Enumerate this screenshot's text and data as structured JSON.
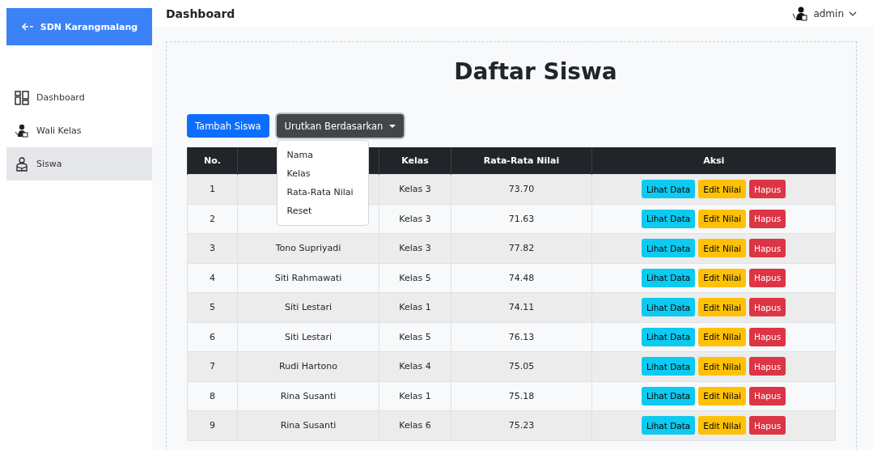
{
  "brand": {
    "title": "SDN Karangmalang"
  },
  "sidebar": {
    "items": [
      {
        "label": "Dashboard",
        "selected": false
      },
      {
        "label": "Wali Kelas",
        "selected": false
      },
      {
        "label": "Siswa",
        "selected": true
      }
    ]
  },
  "header": {
    "title": "Dashboard",
    "user": "admin"
  },
  "page_title": "Daftar Siswa",
  "add_button": "Tambah Siswa",
  "sort_dropdown": {
    "label": "Urutkan Berdasarkan",
    "expanded": true,
    "options": [
      "Nama",
      "Kelas",
      "Rata-Rata Nilai",
      "Reset"
    ]
  },
  "table": {
    "columns": [
      {
        "label": "No."
      },
      {},
      {
        "label": "Kelas"
      },
      {
        "label": "Rata-Rata Nilai"
      },
      {
        "label": "Aksi"
      }
    ],
    "rows": [
      {
        "no": "1",
        "kelas": "Kelas 3",
        "nilai": "73.70",
        "actions": [
          {
            "kind": "view",
            "label": "Lihat Data"
          },
          {
            "kind": "edit",
            "label": "Edit Nilai"
          },
          {
            "kind": "delete",
            "label": "Hapus"
          }
        ]
      },
      {
        "no": "2",
        "kelas": "Kelas 3",
        "nilai": "71.63",
        "actions": [
          {
            "kind": "view",
            "label": "Lihat Data"
          },
          {
            "kind": "edit",
            "label": "Edit Nilai"
          },
          {
            "kind": "delete",
            "label": "Hapus"
          }
        ]
      },
      {
        "no": "3",
        "nama": "Tono Supriyadi",
        "kelas": "Kelas 3",
        "nilai": "77.82",
        "actions": [
          {
            "kind": "view",
            "label": "Lihat Data"
          },
          {
            "kind": "edit",
            "label": "Edit Nilai"
          },
          {
            "kind": "delete",
            "label": "Hapus"
          }
        ]
      },
      {
        "no": "4",
        "nama": "Siti Rahmawati",
        "kelas": "Kelas 5",
        "nilai": "74.48",
        "actions": [
          {
            "kind": "view",
            "label": "Lihat Data"
          },
          {
            "kind": "edit",
            "label": "Edit Nilai"
          },
          {
            "kind": "delete",
            "label": "Hapus"
          }
        ]
      },
      {
        "no": "5",
        "nama": "Siti Lestari",
        "kelas": "Kelas 1",
        "nilai": "74.11",
        "actions": [
          {
            "kind": "view",
            "label": "Lihat Data"
          },
          {
            "kind": "edit",
            "label": "Edit Nilai"
          },
          {
            "kind": "delete",
            "label": "Hapus"
          }
        ]
      },
      {
        "no": "6",
        "nama": "Siti Lestari",
        "kelas": "Kelas 5",
        "nilai": "76.13",
        "actions": [
          {
            "kind": "view",
            "label": "Lihat Data"
          },
          {
            "kind": "edit",
            "label": "Edit Nilai"
          },
          {
            "kind": "delete",
            "label": "Hapus"
          }
        ]
      },
      {
        "no": "7",
        "nama": "Rudi Hartono",
        "kelas": "Kelas 4",
        "nilai": "75.05",
        "actions": [
          {
            "kind": "view",
            "label": "Lihat Data"
          },
          {
            "kind": "edit",
            "label": "Edit Nilai"
          },
          {
            "kind": "delete",
            "label": "Hapus"
          }
        ]
      },
      {
        "no": "8",
        "nama": "Rina Susanti",
        "kelas": "Kelas 1",
        "nilai": "75.18",
        "actions": [
          {
            "kind": "view",
            "label": "Lihat Data"
          },
          {
            "kind": "edit",
            "label": "Edit Nilai"
          },
          {
            "kind": "delete",
            "label": "Hapus"
          }
        ]
      },
      {
        "no": "9",
        "nama": "Rina Susanti",
        "kelas": "Kelas 6",
        "nilai": "75.23",
        "actions": [
          {
            "kind": "view",
            "label": "Lihat Data"
          },
          {
            "kind": "edit",
            "label": "Edit Nilai"
          },
          {
            "kind": "delete",
            "label": "Hapus"
          }
        ]
      }
    ]
  }
}
